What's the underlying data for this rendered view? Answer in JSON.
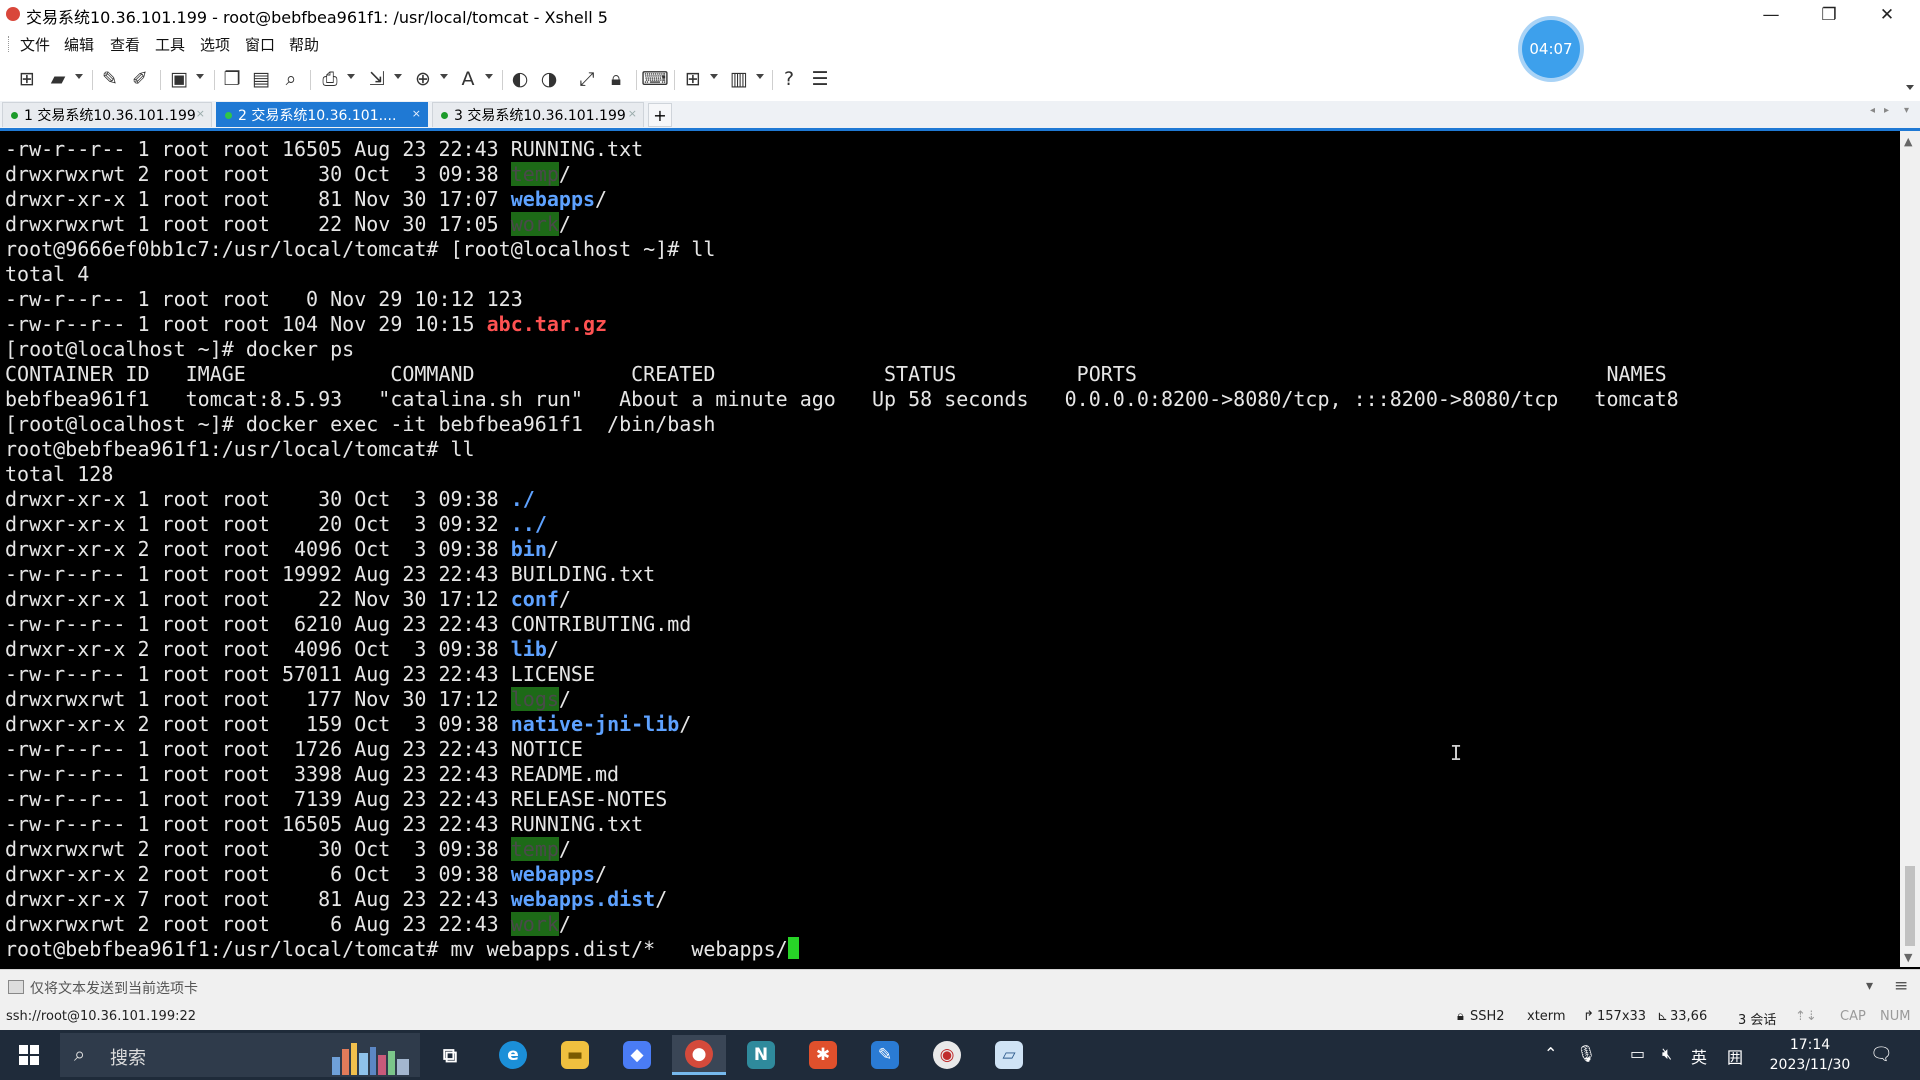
{
  "window": {
    "title": "交易系统10.36.101.199 - root@bebfbea961f1: /usr/local/tomcat - Xshell 5",
    "controls": [
      "—",
      "❐",
      "✕"
    ]
  },
  "timer": "04:07",
  "menu": [
    "文件",
    "编辑",
    "查看",
    "工具",
    "选项",
    "窗口",
    "帮助"
  ],
  "tabs": [
    {
      "label": "1 交易系统10.36.101.199",
      "close": "×"
    },
    {
      "label": "2 交易系统10.36.101....",
      "close": "×"
    },
    {
      "label": "3 交易系统10.36.101.199",
      "close": "×"
    }
  ],
  "tab_add": "+",
  "terminal": {
    "lines": [
      [
        [
          "-rw-r--r-- 1 root root 16505 Aug 23 22:43 RUNNING.txt",
          ""
        ]
      ],
      [
        [
          "drwxrwxrwt 2 root root    30 Oct  3 09:38 ",
          ""
        ],
        [
          "temp",
          "hl"
        ],
        [
          "/",
          ""
        ]
      ],
      [
        [
          "drwxr-xr-x 1 root root    81 Nov 30 17:07 ",
          ""
        ],
        [
          "webapps",
          "dir"
        ],
        [
          "/",
          ""
        ]
      ],
      [
        [
          "drwxrwxrwt 1 root root    22 Nov 30 17:05 ",
          ""
        ],
        [
          "work",
          "hl"
        ],
        [
          "/",
          ""
        ]
      ],
      [
        [
          "root@9666ef0bb1c7:/usr/local/tomcat# [root@localhost ~]# ll",
          ""
        ]
      ],
      [
        [
          "total 4",
          ""
        ]
      ],
      [
        [
          "-rw-r--r-- 1 root root   0 Nov 29 10:12 123",
          ""
        ]
      ],
      [
        [
          "-rw-r--r-- 1 root root 104 Nov 29 10:15 ",
          ""
        ],
        [
          "abc.tar.gz",
          "arc"
        ]
      ],
      [
        [
          "[root@localhost ~]# docker ps",
          ""
        ]
      ],
      [
        [
          "CONTAINER ID   IMAGE            COMMAND             CREATED              STATUS          PORTS                                       NAMES",
          ""
        ]
      ],
      [
        [
          "bebfbea961f1   tomcat:8.5.93   \"catalina.sh run\"   About a minute ago   Up 58 seconds   0.0.0.0:8200->8080/tcp, :::8200->8080/tcp   tomcat8",
          ""
        ]
      ],
      [
        [
          "[root@localhost ~]# docker exec -it bebfbea961f1  /bin/bash",
          ""
        ]
      ],
      [
        [
          "root@bebfbea961f1:/usr/local/tomcat# ll",
          ""
        ]
      ],
      [
        [
          "total 128",
          ""
        ]
      ],
      [
        [
          "drwxr-xr-x 1 root root    30 Oct  3 09:38 ",
          ""
        ],
        [
          "./",
          "dir"
        ]
      ],
      [
        [
          "drwxr-xr-x 1 root root    20 Oct  3 09:32 ",
          ""
        ],
        [
          "../",
          "dir"
        ]
      ],
      [
        [
          "drwxr-xr-x 2 root root  4096 Oct  3 09:38 ",
          ""
        ],
        [
          "bin",
          "dir"
        ],
        [
          "/",
          ""
        ]
      ],
      [
        [
          "-rw-r--r-- 1 root root 19992 Aug 23 22:43 BUILDING.txt",
          ""
        ]
      ],
      [
        [
          "drwxr-xr-x 1 root root    22 Nov 30 17:12 ",
          ""
        ],
        [
          "conf",
          "dir"
        ],
        [
          "/",
          ""
        ]
      ],
      [
        [
          "-rw-r--r-- 1 root root  6210 Aug 23 22:43 CONTRIBUTING.md",
          ""
        ]
      ],
      [
        [
          "drwxr-xr-x 2 root root  4096 Oct  3 09:38 ",
          ""
        ],
        [
          "lib",
          "dir"
        ],
        [
          "/",
          ""
        ]
      ],
      [
        [
          "-rw-r--r-- 1 root root 57011 Aug 23 22:43 LICENSE",
          ""
        ]
      ],
      [
        [
          "drwxrwxrwt 1 root root   177 Nov 30 17:12 ",
          ""
        ],
        [
          "logs",
          "hl"
        ],
        [
          "/",
          ""
        ]
      ],
      [
        [
          "drwxr-xr-x 2 root root   159 Oct  3 09:38 ",
          ""
        ],
        [
          "native-jni-lib",
          "dir"
        ],
        [
          "/",
          ""
        ]
      ],
      [
        [
          "-rw-r--r-- 1 root root  1726 Aug 23 22:43 NOTICE",
          ""
        ]
      ],
      [
        [
          "-rw-r--r-- 1 root root  3398 Aug 23 22:43 README.md",
          ""
        ]
      ],
      [
        [
          "-rw-r--r-- 1 root root  7139 Aug 23 22:43 RELEASE-NOTES",
          ""
        ]
      ],
      [
        [
          "-rw-r--r-- 1 root root 16505 Aug 23 22:43 RUNNING.txt",
          ""
        ]
      ],
      [
        [
          "drwxrwxrwt 2 root root    30 Oct  3 09:38 ",
          ""
        ],
        [
          "temp",
          "hl"
        ],
        [
          "/",
          ""
        ]
      ],
      [
        [
          "drwxr-xr-x 2 root root     6 Oct  3 09:38 ",
          ""
        ],
        [
          "webapps",
          "dir"
        ],
        [
          "/",
          ""
        ]
      ],
      [
        [
          "drwxr-xr-x 7 root root    81 Aug 23 22:43 ",
          ""
        ],
        [
          "webapps.dist",
          "dir"
        ],
        [
          "/",
          ""
        ]
      ],
      [
        [
          "drwxrwxrwt 2 root root     6 Aug 23 22:43 ",
          ""
        ],
        [
          "work",
          "hl"
        ],
        [
          "/",
          ""
        ]
      ],
      [
        [
          "root@bebfbea961f1:/usr/local/tomcat# mv webapps.dist/*   webapps/",
          ""
        ],
        [
          "",
          "cursor"
        ]
      ]
    ]
  },
  "compose_bar": {
    "text": "仅将文本发送到当前选项卡",
    "dropdown": "▾",
    "menu": "≡"
  },
  "statusbar": {
    "connection": "ssh://root@10.36.101.199:22",
    "protocol": "SSH2",
    "term": "xterm",
    "size": "157x33",
    "cursor_pos": "33,66",
    "sessions": "3 会话",
    "cap": "CAP",
    "num": "NUM"
  },
  "taskbar": {
    "search_placeholder": "搜索",
    "time": "17:14",
    "date": "2023/11/30",
    "ime": "英",
    "ime_grid": "囲"
  }
}
